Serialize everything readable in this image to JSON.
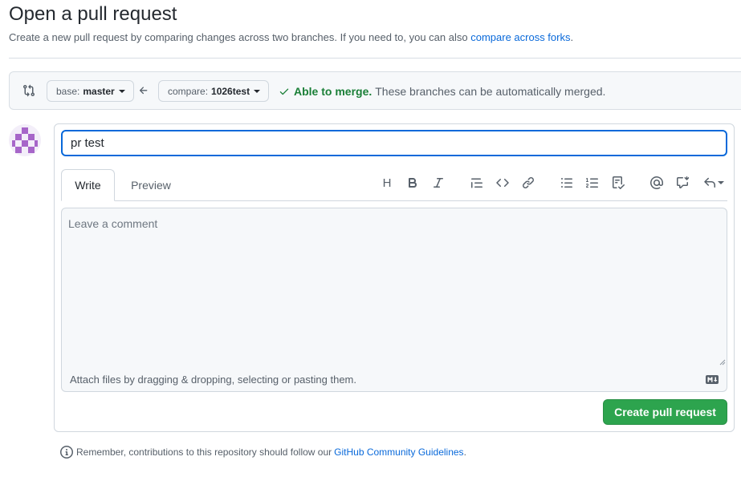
{
  "header": {
    "title": "Open a pull request",
    "subtitle_prefix": "Create a new pull request by comparing changes across two branches. If you need to, you can also ",
    "subtitle_link": "compare across forks",
    "subtitle_suffix": "."
  },
  "compare": {
    "base_prefix": "base:",
    "base_branch": "master",
    "compare_prefix": "compare:",
    "compare_branch": "1026test",
    "merge_status": "Able to merge.",
    "merge_description": "These branches can be automatically merged."
  },
  "form": {
    "title_value": "pr test",
    "tabs": {
      "write": "Write",
      "preview": "Preview"
    },
    "toolbar": {
      "heading": "H"
    },
    "comment_placeholder": "Leave a comment",
    "attach_text": "Attach files by dragging & dropping, selecting or pasting them.",
    "submit_label": "Create pull request"
  },
  "footer": {
    "guidelines_prefix": "Remember, contributions to this repository should follow our ",
    "guidelines_link": "GitHub Community Guidelines",
    "guidelines_suffix": "."
  },
  "colors": {
    "accent": "#0969da",
    "success": "#1a7f37",
    "button": "#2da44e",
    "avatar": "#a766c9"
  },
  "icons": [
    "git-compare-icon",
    "caret-down-icon",
    "arrow-left-icon",
    "check-icon",
    "avatar",
    "heading-icon",
    "bold-icon",
    "italic-icon",
    "quote-icon",
    "code-icon",
    "link-icon",
    "bullet-list-icon",
    "numbered-list-icon",
    "task-list-icon",
    "mention-icon",
    "cross-reference-icon",
    "reply-icon",
    "markdown-icon",
    "info-icon"
  ]
}
